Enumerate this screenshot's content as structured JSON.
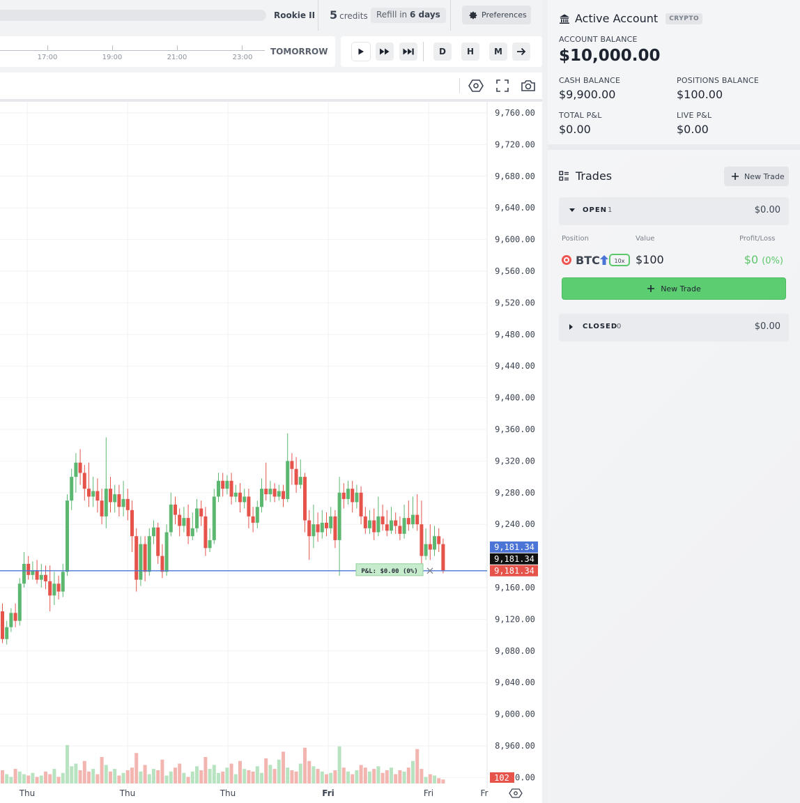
{
  "topbar": {
    "rank": "Rookie II",
    "credits_num": "5",
    "credits_label": "credits",
    "refill_prefix": "Refill in",
    "refill_days": "6 days",
    "preferences": "Preferences"
  },
  "timeline": {
    "times": [
      "17:00",
      "19:00",
      "21:00",
      "23:00"
    ],
    "tomorrow": "TOMORROW"
  },
  "controls": {
    "play": "play-icon",
    "fast": "fast-forward-icon",
    "skip": "skip-end-icon",
    "day": "D",
    "hour": "H",
    "minute": "M",
    "next": "arrow-right-icon"
  },
  "account": {
    "title": "Active Account",
    "badge": "CRYPTO",
    "balance_label": "ACCOUNT BALANCE",
    "balance": "$10,000.00",
    "cash_label": "CASH BALANCE",
    "cash": "$9,900.00",
    "positions_label": "POSITIONS BALANCE",
    "positions": "$100.00",
    "total_pnl_label": "TOTAL P&L",
    "total_pnl": "$0.00",
    "live_pnl_label": "LIVE P&L",
    "live_pnl": "$0.00"
  },
  "trades": {
    "title": "Trades",
    "new_trade": "New Trade",
    "open_label": "OPEN",
    "open_count": "1",
    "open_value": "$0.00",
    "col_position": "Position",
    "col_value": "Value",
    "col_pnl": "Profit/Loss",
    "position": {
      "symbol": "BTC",
      "leverage": "10x",
      "value": "$100",
      "pnl": "$0",
      "pnl_pct": "(0%)"
    },
    "new_trade_big": "New Trade",
    "closed_label": "CLOSED",
    "closed_count": "0",
    "closed_value": "$0.00"
  },
  "chart_data": {
    "type": "candlestick",
    "y_ticks": [
      "9,760.00",
      "9,720.00",
      "9,680.00",
      "9,640.00",
      "9,600.00",
      "9,560.00",
      "9,520.00",
      "9,480.00",
      "9,440.00",
      "9,400.00",
      "9,360.00",
      "9,320.00",
      "9,280.00",
      "9,240.00",
      "9,160.00",
      "9,120.00",
      "9,080.00",
      "9,040.00",
      "9,000.00",
      "8,960.00",
      "8,920.00"
    ],
    "x_ticks": [
      "Thu",
      "Thu",
      "Thu",
      "Fri",
      "Fri",
      "Fr"
    ],
    "ylim": [
      8905,
      9780
    ],
    "price_labels": {
      "entry": "9,181.34",
      "current": "9,181.34",
      "last": "9,181.34",
      "volume": "102"
    },
    "position_label": "P&L: $0.00 (0%)",
    "colors": {
      "up": "#5cb870",
      "down": "#e5534b",
      "line": "#4a74d6"
    },
    "candles": [
      [
        9130,
        9095,
        9140,
        9090
      ],
      [
        9095,
        9110,
        9118,
        9088
      ],
      [
        9110,
        9128,
        9134,
        9104
      ],
      [
        9128,
        9118,
        9140,
        9110
      ],
      [
        9118,
        9165,
        9172,
        9112
      ],
      [
        9165,
        9190,
        9205,
        9160
      ],
      [
        9190,
        9176,
        9200,
        9170
      ],
      [
        9176,
        9182,
        9193,
        9170
      ],
      [
        9182,
        9170,
        9195,
        9165
      ],
      [
        9170,
        9176,
        9190,
        9160
      ],
      [
        9176,
        9168,
        9188,
        9158
      ],
      [
        9168,
        9150,
        9188,
        9130
      ],
      [
        9150,
        9165,
        9180,
        9138
      ],
      [
        9165,
        9155,
        9175,
        9145
      ],
      [
        9155,
        9180,
        9190,
        9148
      ],
      [
        9180,
        9270,
        9278,
        9175
      ],
      [
        9270,
        9300,
        9310,
        9258
      ],
      [
        9300,
        9318,
        9330,
        9280
      ],
      [
        9318,
        9305,
        9335,
        9290
      ],
      [
        9305,
        9285,
        9315,
        9270
      ],
      [
        9285,
        9275,
        9318,
        9262
      ],
      [
        9275,
        9282,
        9300,
        9262
      ],
      [
        9282,
        9270,
        9298,
        9255
      ],
      [
        9270,
        9250,
        9285,
        9240
      ],
      [
        9250,
        9285,
        9350,
        9235
      ],
      [
        9285,
        9268,
        9300,
        9255
      ],
      [
        9268,
        9278,
        9290,
        9255
      ],
      [
        9278,
        9262,
        9290,
        9250
      ],
      [
        9262,
        9272,
        9295,
        9250
      ],
      [
        9272,
        9258,
        9285,
        9245
      ],
      [
        9258,
        9225,
        9270,
        9205
      ],
      [
        9225,
        9170,
        9235,
        9155
      ],
      [
        9170,
        9215,
        9225,
        9162
      ],
      [
        9215,
        9180,
        9225,
        9168
      ],
      [
        9180,
        9225,
        9235,
        9175
      ],
      [
        9225,
        9236,
        9245,
        9215
      ],
      [
        9236,
        9200,
        9242,
        9190
      ],
      [
        9200,
        9180,
        9215,
        9172
      ],
      [
        9180,
        9230,
        9240,
        9175
      ],
      [
        9230,
        9265,
        9280,
        9225
      ],
      [
        9265,
        9252,
        9275,
        9240
      ],
      [
        9252,
        9238,
        9260,
        9225
      ],
      [
        9238,
        9248,
        9262,
        9230
      ],
      [
        9248,
        9225,
        9265,
        9215
      ],
      [
        9225,
        9235,
        9255,
        9220
      ],
      [
        9235,
        9260,
        9272,
        9230
      ],
      [
        9260,
        9250,
        9270,
        9238
      ],
      [
        9250,
        9210,
        9262,
        9200
      ],
      [
        9210,
        9220,
        9235,
        9205
      ],
      [
        9220,
        9275,
        9285,
        9215
      ],
      [
        9275,
        9295,
        9305,
        9268
      ],
      [
        9295,
        9285,
        9305,
        9275
      ],
      [
        9285,
        9295,
        9302,
        9278
      ],
      [
        9295,
        9275,
        9305,
        9265
      ],
      [
        9275,
        9280,
        9290,
        9268
      ],
      [
        9280,
        9268,
        9292,
        9255
      ],
      [
        9268,
        9275,
        9285,
        9260
      ],
      [
        9275,
        9250,
        9285,
        9235
      ],
      [
        9250,
        9242,
        9262,
        9230
      ],
      [
        9242,
        9262,
        9270,
        9235
      ],
      [
        9262,
        9285,
        9298,
        9255
      ],
      [
        9285,
        9278,
        9318,
        9270
      ],
      [
        9278,
        9285,
        9295,
        9268
      ],
      [
        9285,
        9275,
        9292,
        9268
      ],
      [
        9275,
        9282,
        9290,
        9270
      ],
      [
        9282,
        9272,
        9290,
        9262
      ],
      [
        9272,
        9320,
        9355,
        9268
      ],
      [
        9320,
        9310,
        9330,
        9290
      ],
      [
        9310,
        9290,
        9325,
        9280
      ],
      [
        9290,
        9300,
        9322,
        9285
      ],
      [
        9300,
        9245,
        9305,
        9230
      ],
      [
        9245,
        9225,
        9258,
        9195
      ],
      [
        9225,
        9240,
        9265,
        9210
      ],
      [
        9240,
        9230,
        9255,
        9218
      ],
      [
        9230,
        9242,
        9258,
        9222
      ],
      [
        9242,
        9235,
        9255,
        9225
      ],
      [
        9235,
        9250,
        9262,
        9228
      ],
      [
        9250,
        9220,
        9258,
        9210
      ],
      [
        9220,
        9280,
        9300,
        9175
      ],
      [
        9280,
        9272,
        9292,
        9260
      ],
      [
        9272,
        9285,
        9295,
        9265
      ],
      [
        9285,
        9268,
        9295,
        9255
      ],
      [
        9268,
        9280,
        9290,
        9260
      ],
      [
        9280,
        9250,
        9288,
        9240
      ],
      [
        9250,
        9235,
        9262,
        9228
      ],
      [
        9235,
        9245,
        9258,
        9228
      ],
      [
        9245,
        9230,
        9260,
        9220
      ],
      [
        9230,
        9250,
        9275,
        9225
      ],
      [
        9250,
        9240,
        9265,
        9232
      ],
      [
        9240,
        9232,
        9258,
        9225
      ],
      [
        9232,
        9245,
        9262,
        9228
      ],
      [
        9245,
        9238,
        9255,
        9228
      ],
      [
        9238,
        9228,
        9250,
        9220
      ],
      [
        9228,
        9248,
        9265,
        9222
      ],
      [
        9248,
        9240,
        9270,
        9232
      ],
      [
        9240,
        9252,
        9275,
        9235
      ],
      [
        9252,
        9240,
        9278,
        9232
      ],
      [
        9240,
        9200,
        9270,
        9185
      ],
      [
        9200,
        9215,
        9235,
        9195
      ],
      [
        9215,
        9208,
        9240,
        9195
      ],
      [
        9208,
        9225,
        9238,
        9200
      ],
      [
        9225,
        9215,
        9235,
        9205
      ],
      [
        9215,
        9181,
        9222,
        9178
      ]
    ],
    "volumes": [
      20,
      14,
      10,
      22,
      18,
      14,
      12,
      16,
      10,
      12,
      18,
      14,
      22,
      10,
      16,
      58,
      26,
      30,
      20,
      34,
      18,
      22,
      14,
      40,
      28,
      18,
      22,
      12,
      16,
      20,
      24,
      46,
      18,
      28,
      14,
      22,
      20,
      36,
      12,
      18,
      24,
      30,
      16,
      10,
      18,
      26,
      20,
      40,
      22,
      28,
      16,
      18,
      24,
      30,
      14,
      34,
      22,
      20,
      18,
      26,
      16,
      38,
      28,
      22,
      36,
      48,
      24,
      20,
      18,
      30,
      54,
      34,
      26,
      22,
      18,
      14,
      16,
      20,
      56,
      24,
      18,
      14,
      20,
      28,
      24,
      18,
      22,
      26,
      16,
      20,
      24,
      14,
      20,
      18,
      24,
      34,
      52,
      22,
      10,
      14,
      12,
      8,
      6
    ]
  }
}
